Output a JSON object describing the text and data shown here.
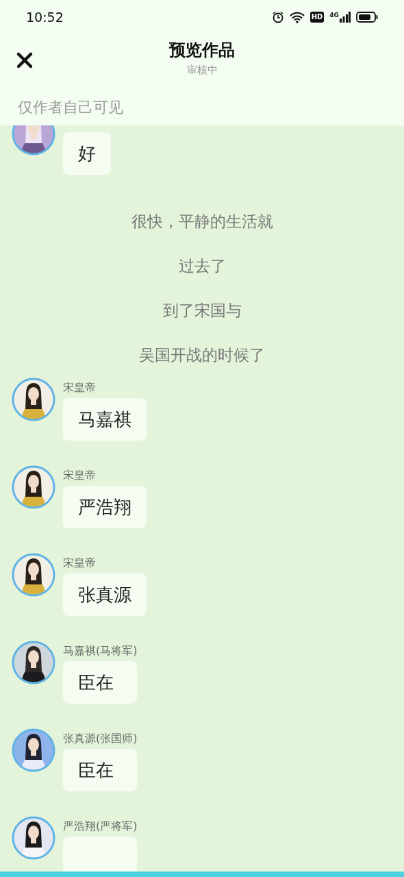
{
  "status_bar": {
    "time": "10:52",
    "hd": "HD",
    "network": "4G"
  },
  "header": {
    "title": "预览作品",
    "subtitle": "审核中"
  },
  "notice": "仅作者自己可见",
  "feed": [
    {
      "kind": "message",
      "text": "好"
    },
    {
      "kind": "narration",
      "text": "很快，平静的生活就"
    },
    {
      "kind": "narration",
      "text": "过去了"
    },
    {
      "kind": "narration",
      "text": "到了宋国与"
    },
    {
      "kind": "narration",
      "text": "吴国开战的时候了"
    },
    {
      "kind": "message",
      "speaker": "宋皇帝",
      "text": "马嘉祺"
    },
    {
      "kind": "message",
      "speaker": "宋皇帝",
      "text": "严浩翔"
    },
    {
      "kind": "message",
      "speaker": "宋皇帝",
      "text": "张真源"
    },
    {
      "kind": "message",
      "speaker": "马嘉祺(马将军)",
      "text": "臣在"
    },
    {
      "kind": "message",
      "speaker": "张真源(张国师)",
      "text": "臣在"
    },
    {
      "kind": "message",
      "speaker": "严浩翔(严将军)"
    }
  ]
}
